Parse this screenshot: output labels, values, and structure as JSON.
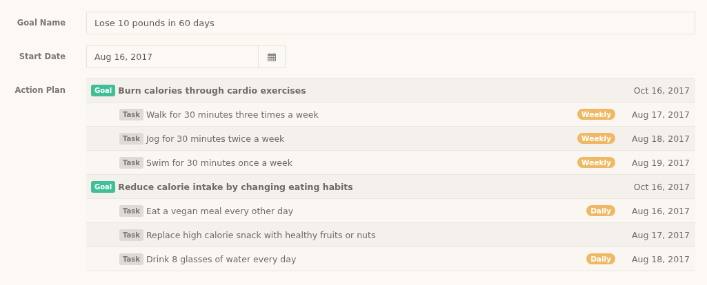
{
  "fields": [
    {
      "kind": "text",
      "label": "Goal Name",
      "value": "Lose 10 pounds in 60 days"
    },
    {
      "kind": "date",
      "label": "Start Date",
      "value": "Aug 16, 2017"
    }
  ],
  "action_plan": {
    "label": "Action Plan",
    "goals": [
      {
        "tag": "Goal",
        "text": "Burn calories through cardio exercises",
        "date": "Oct 16, 2017",
        "children": [
          {
            "tag": "Task",
            "text": "Walk for 30 minutes three times a week",
            "frequency": "Weekly",
            "date": "Aug 17, 2017"
          },
          {
            "tag": "Task",
            "text": "Jog for 30 minutes twice a week",
            "frequency": "Weekly",
            "date": "Aug 18, 2017"
          },
          {
            "tag": "Task",
            "text": "Swim for 30 minutes once a week",
            "frequency": "Weekly",
            "date": "Aug 19, 2017"
          }
        ]
      },
      {
        "tag": "Goal",
        "text": "Reduce calorie intake by changing eating habits",
        "date": "Oct 16, 2017",
        "children": [
          {
            "tag": "Task",
            "text": "Eat a vegan meal every other day",
            "frequency": "Daily",
            "date": "Aug 16, 2017"
          },
          {
            "tag": "Task",
            "text": "Replace high calorie snack with healthy fruits or nuts",
            "date": "Aug 17, 2017"
          },
          {
            "tag": "Task",
            "text": "Drink 8 glasses of water every day",
            "frequency": "Daily",
            "date": "Aug 18, 2017"
          }
        ]
      }
    ]
  }
}
